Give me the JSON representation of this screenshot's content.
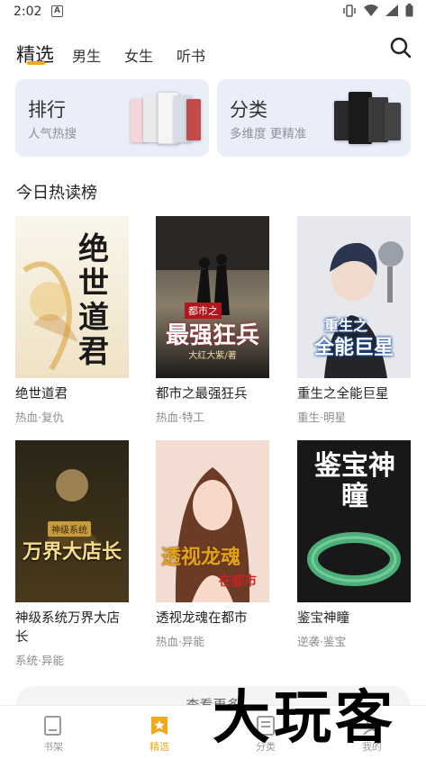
{
  "status_bar": {
    "time": "2:02",
    "notification_glyph": "A"
  },
  "tabs": [
    {
      "label": "精选",
      "active": true
    },
    {
      "label": "男生",
      "active": false
    },
    {
      "label": "女生",
      "active": false
    },
    {
      "label": "听书",
      "active": false
    }
  ],
  "cards": {
    "rank": {
      "title": "排行",
      "subtitle": "人气热搜"
    },
    "category": {
      "title": "分类",
      "subtitle": "多维度 更精准"
    }
  },
  "section": {
    "title": "今日热读榜"
  },
  "books": [
    {
      "title": "绝世道君",
      "tags": "热血·复仇",
      "cover_text": "绝世道君",
      "cover_author": ""
    },
    {
      "title": "都市之最强狂兵",
      "tags": "热血·特工",
      "cover_text": "最强狂兵",
      "cover_author": "大红大紫/著",
      "cover_badge": "都市之"
    },
    {
      "title": "重生之全能巨星",
      "tags": "重生·明星",
      "cover_text": "全能巨星",
      "cover_author": "",
      "cover_badge": "重生之"
    },
    {
      "title": "神级系统万界大店长",
      "tags": "系统·异能",
      "cover_text": "万界大店长",
      "cover_author": "",
      "cover_badge": "神级系统"
    },
    {
      "title": "透视龙魂在都市",
      "tags": "热血·异能",
      "cover_text": "透视龙魂",
      "cover_author": "",
      "cover_badge": "在都市"
    },
    {
      "title": "鉴宝神瞳",
      "tags": "逆袭·鉴宝",
      "cover_text": "鉴宝神瞳",
      "cover_author": ""
    }
  ],
  "more_button": {
    "label": "查看更多"
  },
  "bottom_nav": [
    {
      "label": "书架",
      "active": false
    },
    {
      "label": "精选",
      "active": true
    },
    {
      "label": "分类",
      "active": false
    },
    {
      "label": "我的",
      "active": false
    }
  ],
  "watermark": {
    "text": "大玩客"
  },
  "colors": {
    "accent": "#f2a81d",
    "card_bg": "#e9eef8"
  }
}
